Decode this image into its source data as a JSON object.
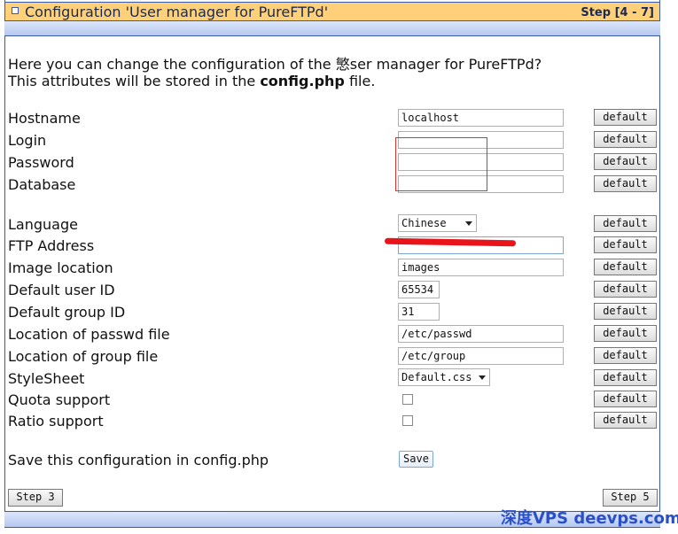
{
  "header": {
    "title": "Configuration 'User manager for PureFTPd'",
    "step": "Step [4 - 7]"
  },
  "intro": {
    "line1": "Here you can change the configuration of the 慜ser manager for PureFTPd?",
    "line2_prefix": "This attributes will be stored in the ",
    "line2_file": "config.php",
    "line2_suffix": " file."
  },
  "fields": {
    "hostname": {
      "label": "Hostname",
      "value": "localhost"
    },
    "login": {
      "label": "Login",
      "value": ""
    },
    "password": {
      "label": "Password",
      "value": ""
    },
    "database": {
      "label": "Database",
      "value": ""
    },
    "language": {
      "label": "Language",
      "value": "Chinese"
    },
    "ftp_address": {
      "label": "FTP Address",
      "value": ""
    },
    "image_location": {
      "label": "Image location",
      "value": "images"
    },
    "default_uid": {
      "label": "Default user ID",
      "value": "65534"
    },
    "default_gid": {
      "label": "Default group ID",
      "value": "31"
    },
    "passwd_file": {
      "label": "Location of passwd file",
      "value": "/etc/passwd"
    },
    "group_file": {
      "label": "Location of group file",
      "value": "/etc/group"
    },
    "stylesheet": {
      "label": "StyleSheet",
      "value": "Default.css"
    },
    "quota": {
      "label": "Quota support",
      "checked": false
    },
    "ratio": {
      "label": "Ratio support",
      "checked": false
    }
  },
  "default_label": "default",
  "save": {
    "label": "Save this configuration in config.php",
    "button": "Save"
  },
  "nav": {
    "prev": "Step 3",
    "next": "Step 5"
  },
  "watermark": "深度VPS deevps.com"
}
